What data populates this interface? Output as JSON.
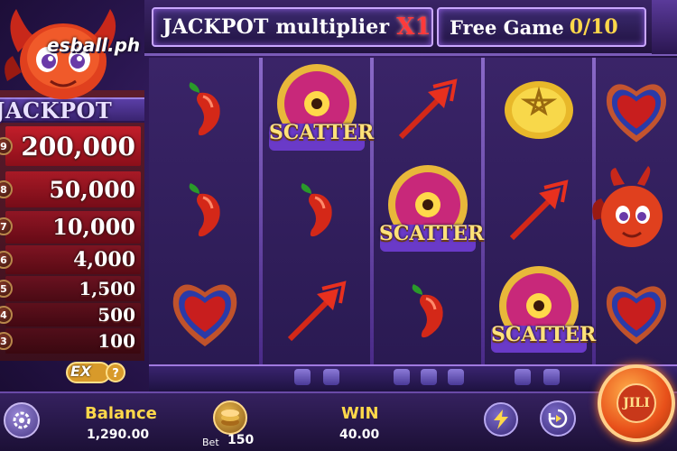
{
  "logo": {
    "text": "esball.ph"
  },
  "header": {
    "multiplier_label": "JACKPOT multiplier",
    "multiplier_value": "X1",
    "free_game_label": "Free Game",
    "free_game_value": "0/10"
  },
  "jackpot": {
    "title": "JACKPOT",
    "tiers": [
      {
        "badge": "9",
        "value": "200,000"
      },
      {
        "badge": "8",
        "value": "50,000"
      },
      {
        "badge": "7",
        "value": "10,000"
      },
      {
        "badge": "6",
        "value": "4,000"
      },
      {
        "badge": "5",
        "value": "1,500"
      },
      {
        "badge": "4",
        "value": "500"
      },
      {
        "badge": "3",
        "value": "100"
      }
    ]
  },
  "reels": {
    "scatter_label": "SCATTER",
    "grid": [
      [
        "chili",
        "chili",
        "heart"
      ],
      [
        "scatter",
        "chili",
        "trident"
      ],
      [
        "trident",
        "scatter",
        "chili"
      ],
      [
        "coin",
        "trident",
        "scatter"
      ],
      [
        "heart",
        "devil",
        "heart"
      ]
    ]
  },
  "controls": {
    "ex_label": "EX",
    "balance_label": "Balance",
    "balance_value": "1,290.00",
    "bet_label": "Bet",
    "bet_value": "150",
    "win_label": "WIN",
    "win_value": "40.00",
    "spin_label": "JILI"
  },
  "colors": {
    "accent_gold": "#ffd84a",
    "multiplier_red": "#ff3a3a",
    "panel_purple": "#3b2a6e",
    "jackpot_red": "#5c1c2c"
  }
}
